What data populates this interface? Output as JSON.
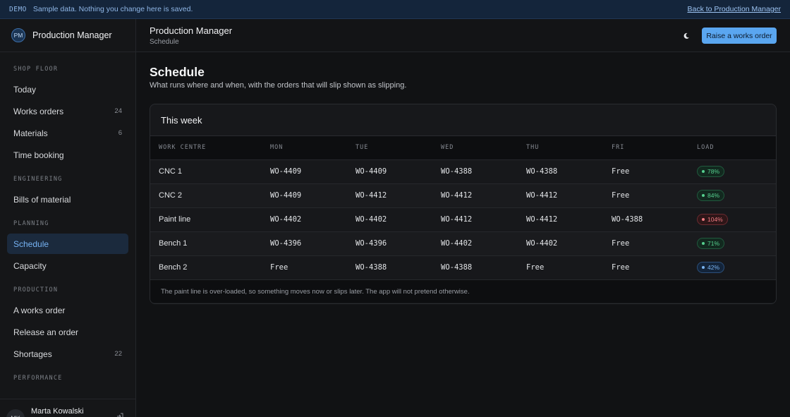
{
  "banner": {
    "tag": "DEMO",
    "message": "Sample data. Nothing you change here is saved.",
    "back_link": "Back to Production Manager"
  },
  "sidebar": {
    "brand": {
      "initials": "PM",
      "name": "Production Manager"
    },
    "sections": [
      {
        "label": "SHOP FLOOR",
        "items": [
          {
            "label": "Today",
            "count": ""
          },
          {
            "label": "Works orders",
            "count": "24"
          },
          {
            "label": "Materials",
            "count": "6"
          },
          {
            "label": "Time booking",
            "count": ""
          }
        ]
      },
      {
        "label": "ENGINEERING",
        "items": [
          {
            "label": "Bills of material",
            "count": ""
          }
        ]
      },
      {
        "label": "PLANNING",
        "items": [
          {
            "label": "Schedule",
            "count": "",
            "active": true
          },
          {
            "label": "Capacity",
            "count": ""
          }
        ]
      },
      {
        "label": "PRODUCTION",
        "items": [
          {
            "label": "A works order",
            "count": ""
          },
          {
            "label": "Release an order",
            "count": ""
          },
          {
            "label": "Shortages",
            "count": "22"
          }
        ]
      },
      {
        "label": "PERFORMANCE",
        "items": []
      }
    ],
    "user": {
      "initials": "MK",
      "name": "Marta Kowalski"
    }
  },
  "header": {
    "title": "Production Manager",
    "breadcrumb": "Schedule",
    "theme_icon": "moon-icon",
    "primary_button": "Raise a works order"
  },
  "page": {
    "title": "Schedule",
    "subtitle": "What runs where and when, with the orders that will slip shown as slipping."
  },
  "schedule": {
    "card_title": "This week",
    "columns": [
      "WORK CENTRE",
      "MON",
      "TUE",
      "WED",
      "THU",
      "FRI",
      "LOAD"
    ],
    "rows": [
      {
        "centre": "CNC 1",
        "days": [
          "WO-4409",
          "WO-4409",
          "WO-4388",
          "WO-4388",
          "Free"
        ],
        "load": "78%",
        "status": "ok"
      },
      {
        "centre": "CNC 2",
        "days": [
          "WO-4409",
          "WO-4412",
          "WO-4412",
          "WO-4412",
          "Free"
        ],
        "load": "84%",
        "status": "ok"
      },
      {
        "centre": "Paint line",
        "days": [
          "WO-4402",
          "WO-4402",
          "WO-4412",
          "WO-4412",
          "WO-4388"
        ],
        "load": "104%",
        "status": "over"
      },
      {
        "centre": "Bench 1",
        "days": [
          "WO-4396",
          "WO-4396",
          "WO-4402",
          "WO-4402",
          "Free"
        ],
        "load": "71%",
        "status": "ok"
      },
      {
        "centre": "Bench 2",
        "days": [
          "Free",
          "WO-4388",
          "WO-4388",
          "Free",
          "Free"
        ],
        "load": "42%",
        "status": "low"
      }
    ],
    "footnote": "The paint line is over-loaded, so something moves now or slips later. The app will not pretend otherwise."
  },
  "colors": {
    "accent": "#5aa6f0",
    "load_ok": "#55cf8e",
    "load_over": "#f07b82",
    "load_low": "#7ab4f2"
  }
}
